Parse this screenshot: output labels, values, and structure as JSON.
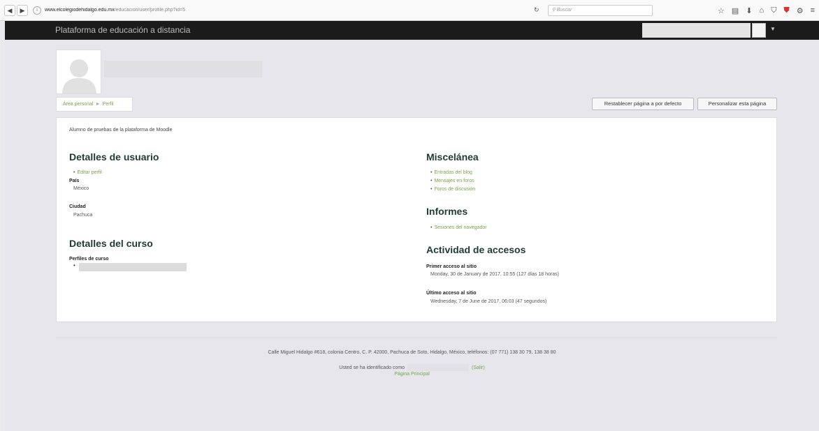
{
  "browser": {
    "url_host": "www.elcolegiodehidalgo.edu.mx",
    "url_path": "/educacion/user/profile.php?id=5",
    "search_placeholder": "Buscar"
  },
  "navbar": {
    "brand": "Plataforma de educación a distancia"
  },
  "breadcrumb": {
    "items": [
      "Área personal",
      "Perfil"
    ],
    "separator": "►"
  },
  "buttons": {
    "reset": "Restablecer página a por defecto",
    "customize": "Personalizar esta página"
  },
  "profile": {
    "description": "Alumno de pruebas de la plataforma de Moodle",
    "user_details": {
      "heading": "Detalles de usuario",
      "edit_link": "Editar perfil",
      "country_label": "País",
      "country_value": "México",
      "city_label": "Ciudad",
      "city_value": "Pachuca"
    },
    "course_details": {
      "heading": "Detalles del curso",
      "profiles_label": "Perfiles de curso"
    },
    "misc": {
      "heading": "Miscelánea",
      "links": [
        "Entradas del blog",
        "Mensajes en foros",
        "Foros de discusión"
      ]
    },
    "reports": {
      "heading": "Informes",
      "links": [
        "Sesiones del navegador"
      ]
    },
    "access": {
      "heading": "Actividad de accesos",
      "first_label": "Primer acceso al sitio",
      "first_value": "Monday, 30 de January de 2017, 10:55  (127 días 18 horas)",
      "last_label": "Último acceso al sitio",
      "last_value": "Wednesday, 7 de June de 2017, 06:03  (47 segundos)"
    }
  },
  "footer": {
    "address": "Calle Miguel Hidalgo #618, colonia Centro, C. P. 42000, Pachuca de Soto, Hidalgo, México, teléfonos: (07 771) 138 30 79, 138 38 80",
    "logged_in_prefix": "Usted se ha identificado como",
    "logout": "(Salir)",
    "home": "Página Principal"
  }
}
